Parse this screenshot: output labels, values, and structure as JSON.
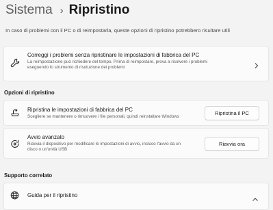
{
  "breadcrumb": {
    "parent": "Sistema",
    "separator": "›",
    "current": "Ripristino"
  },
  "intro": "In caso di problemi con il PC o di reimpostarla, queste opzioni di ripristino potrebbero risultare utili",
  "troubleshoot_card": {
    "icon": "wrench-icon",
    "title": "Correggi i problemi senza ripristinare le impostazioni di fabbrica del PC",
    "description_line1": "La reimpostazione può richiedere del tempo. Prima di reimpostare, prova a risolvere i problemi",
    "description_line2": "eseguendo lo strumento di risoluzione dei problemi",
    "chevron": "chevron-right-icon"
  },
  "recovery_options": {
    "heading": "Opzioni di ripristino",
    "reset": {
      "icon": "reset-pc-icon",
      "title": "Ripristina le impostazioni di fabbrica del PC",
      "description": "Scegliere se mantenere o rimuovere i file personali, quindi reinstallare Windows",
      "button": "Ripristina il PC"
    },
    "advanced": {
      "icon": "advanced-startup-icon",
      "title": "Avvio avanzato",
      "description_line1": "Riavvia il dispositivo per modificare le impostazioni di avvio, incluso l'avvio da un",
      "description_line2": "disco o un'unità USB",
      "button": "Riavvia ora"
    }
  },
  "related_support": {
    "heading": "Supporto correlato",
    "item": {
      "icon": "globe-icon",
      "title": "Guida per il ripristino",
      "chevron": "chevron-up-icon"
    }
  }
}
